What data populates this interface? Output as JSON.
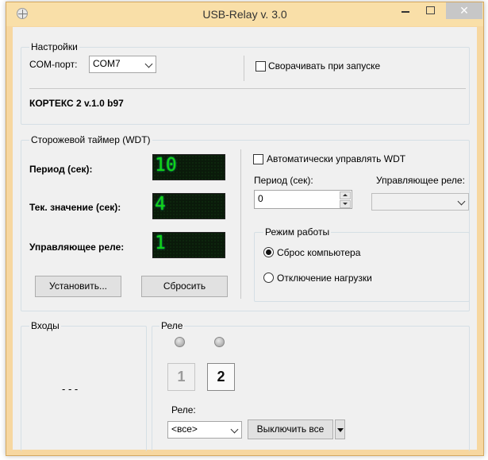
{
  "window": {
    "title": "USB-Relay v. 3.0",
    "close_glyph": "✕"
  },
  "settings": {
    "group_title": "Настройки",
    "com_label": "COM-порт:",
    "com_value": "COM7",
    "minimize_label": "Сворачивать при запуске",
    "minimize_checked": false,
    "device_info": "КОРТЕКС 2 v.1.0 b97"
  },
  "wdt": {
    "group_title": "Сторожевой таймер (WDT)",
    "period_label": "Период (сек):",
    "period_display": "10",
    "current_label": "Тек. значение (сек):",
    "current_display": "4",
    "relay_label": "Управляющее реле:",
    "relay_display": "1",
    "set_button": "Установить...",
    "reset_button": "Сбросить",
    "auto_label": "Автоматически управлять WDT",
    "auto_checked": false,
    "period_input_label": "Период (сек):",
    "period_input_value": "0",
    "control_relay_label": "Управляющее реле:",
    "control_relay_value": "",
    "mode": {
      "group_title": "Режим работы",
      "option_reset": "Сброс компьютера",
      "option_load": "Отключение нагрузки",
      "selected": "reset"
    }
  },
  "inputs": {
    "group_title": "Входы",
    "value": "- - -"
  },
  "relays": {
    "group_title": "Реле",
    "buttons": [
      {
        "label": "1",
        "active": false
      },
      {
        "label": "2",
        "active": true
      }
    ],
    "select_label": "Реле:",
    "select_value": "<все>",
    "off_all_button": "Выключить все"
  },
  "colors": {
    "led_digits": "#14d414",
    "title_bar": "#f9dfa8",
    "close_button": "#c7c7c7"
  }
}
